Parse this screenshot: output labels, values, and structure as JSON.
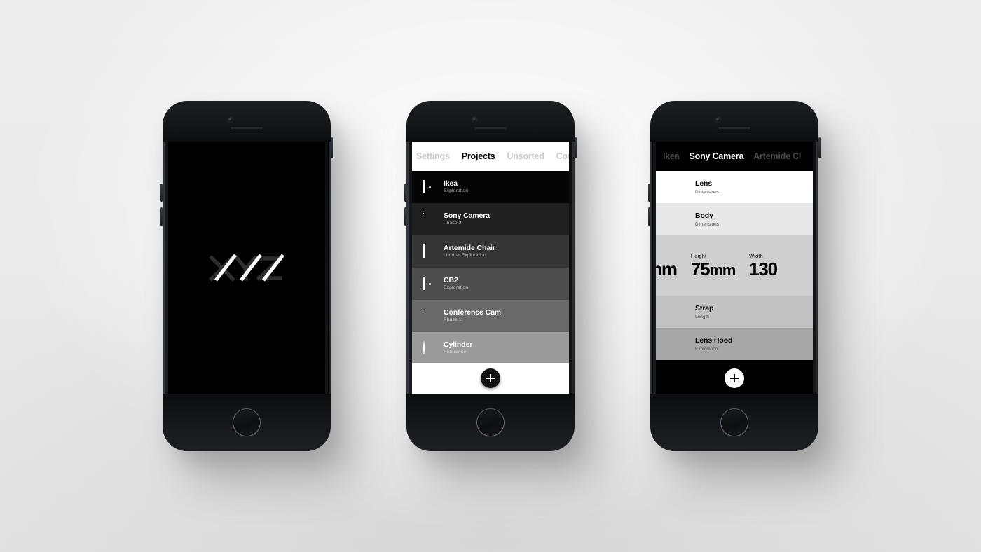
{
  "scene": {
    "background_color": "#e9e9e9",
    "device_count": 3
  },
  "phone_one": {
    "screen_name": "splash-screen",
    "background_color": "#010101",
    "logo_text": "XYZ",
    "logo_accent_color": "#ffffff",
    "logo_base_color": "#2c2c2c"
  },
  "phone_two": {
    "screen_name": "projects-list",
    "navbar": {
      "background_color": "#ffffff",
      "tabs": [
        {
          "label": "Settings",
          "active": false
        },
        {
          "label": "Projects",
          "active": true
        },
        {
          "label": "Unsorted",
          "active": false
        },
        {
          "label": "Con",
          "active": false
        }
      ]
    },
    "rows": [
      {
        "title": "Ikea",
        "subtitle": "Exploration",
        "icon": "square-dot-icon",
        "bg": "#050505"
      },
      {
        "title": "Sony Camera",
        "subtitle": "Phase 2",
        "icon": "triangle-fill-icon",
        "bg": "#202020"
      },
      {
        "title": "Artemide Chair",
        "subtitle": "Lumbar Exploration",
        "icon": "square-diagonal-icon",
        "bg": "#353535"
      },
      {
        "title": "CB2",
        "subtitle": "Exploration",
        "icon": "square-dot-icon",
        "bg": "#4d4d4d"
      },
      {
        "title": "Conference Cam",
        "subtitle": "Phase 1",
        "icon": "triangle-fill-icon",
        "bg": "#6a6a6a"
      },
      {
        "title": "Cylinder",
        "subtitle": "Reference",
        "icon": "circle-icon",
        "bg": "#9a9a9a"
      }
    ],
    "fab": {
      "label": "+",
      "style": "dark-on-white",
      "bar_color": "#ffffff"
    }
  },
  "phone_three": {
    "screen_name": "project-detail",
    "navbar": {
      "background_color": "#000000",
      "tabs": [
        {
          "label": "Ikea",
          "active": false
        },
        {
          "label": "Sony Camera",
          "active": true
        },
        {
          "label": "Artemide Cl",
          "active": false
        }
      ]
    },
    "rows": [
      {
        "title": "Lens",
        "subtitle": "Dimensions",
        "bg": "#ffffff"
      },
      {
        "title": "Body",
        "subtitle": "Dimensions",
        "bg": "#e8e8e8"
      }
    ],
    "measurements_row": {
      "background_color": "#cfcfcf",
      "items": [
        {
          "label": "",
          "value": "mm",
          "clipped": true
        },
        {
          "label": "Height",
          "value": "75",
          "unit": "mm"
        },
        {
          "label": "Width",
          "value": "130",
          "unit": ""
        }
      ]
    },
    "rows_lower": [
      {
        "title": "Strap",
        "subtitle": "Length",
        "bg": "#c2c2c2"
      },
      {
        "title": "Lens Hood",
        "subtitle": "Exploration",
        "bg": "#a8a8a8"
      }
    ],
    "fab": {
      "label": "+",
      "style": "white-on-dark",
      "bar_color": "#000000"
    }
  }
}
